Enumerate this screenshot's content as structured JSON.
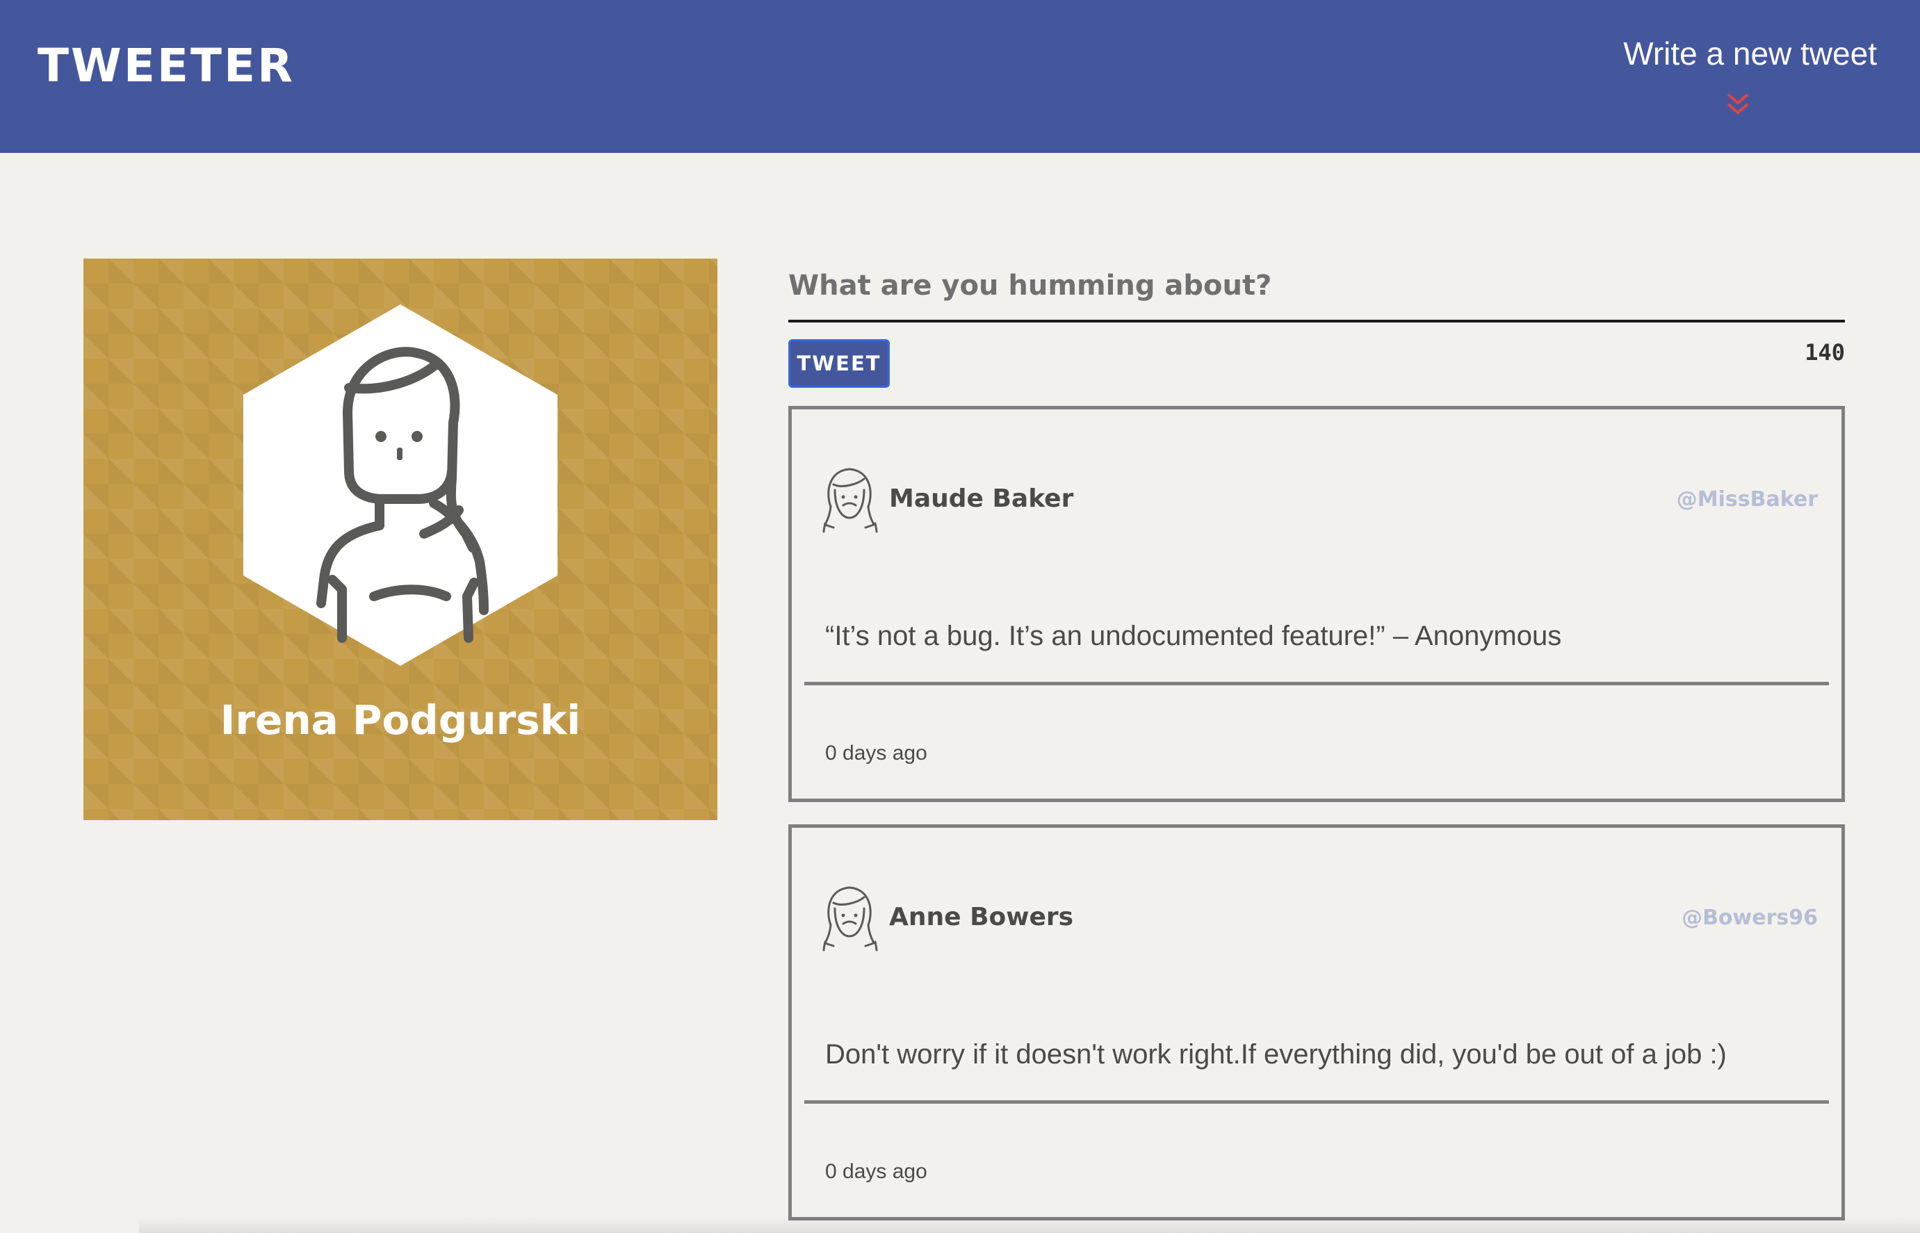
{
  "nav": {
    "brand": "TWEETER",
    "compose_toggle": "Write a new tweet",
    "toggle_icon": "double-chevron-down-icon",
    "accent": "#e0453e"
  },
  "profile": {
    "name": "Irena Podgurski",
    "background": "#c49c48"
  },
  "composer": {
    "placeholder": "What are you humming about?",
    "button_label": "TWEET",
    "counter": "140"
  },
  "tweets": [
    {
      "author": "Maude Baker",
      "handle": "@MissBaker",
      "content": "“It’s not a bug. It’s an undocumented feature!” – Anonymous",
      "time": "0 days ago",
      "avatar_icon": "woman-avatar-icon"
    },
    {
      "author": "Anne Bowers",
      "handle": "@Bowers96",
      "content": "Don't worry if it doesn't work right.If everything did, you'd be out of a job :)",
      "time": "0 days ago",
      "avatar_icon": "woman-avatar-icon"
    }
  ]
}
